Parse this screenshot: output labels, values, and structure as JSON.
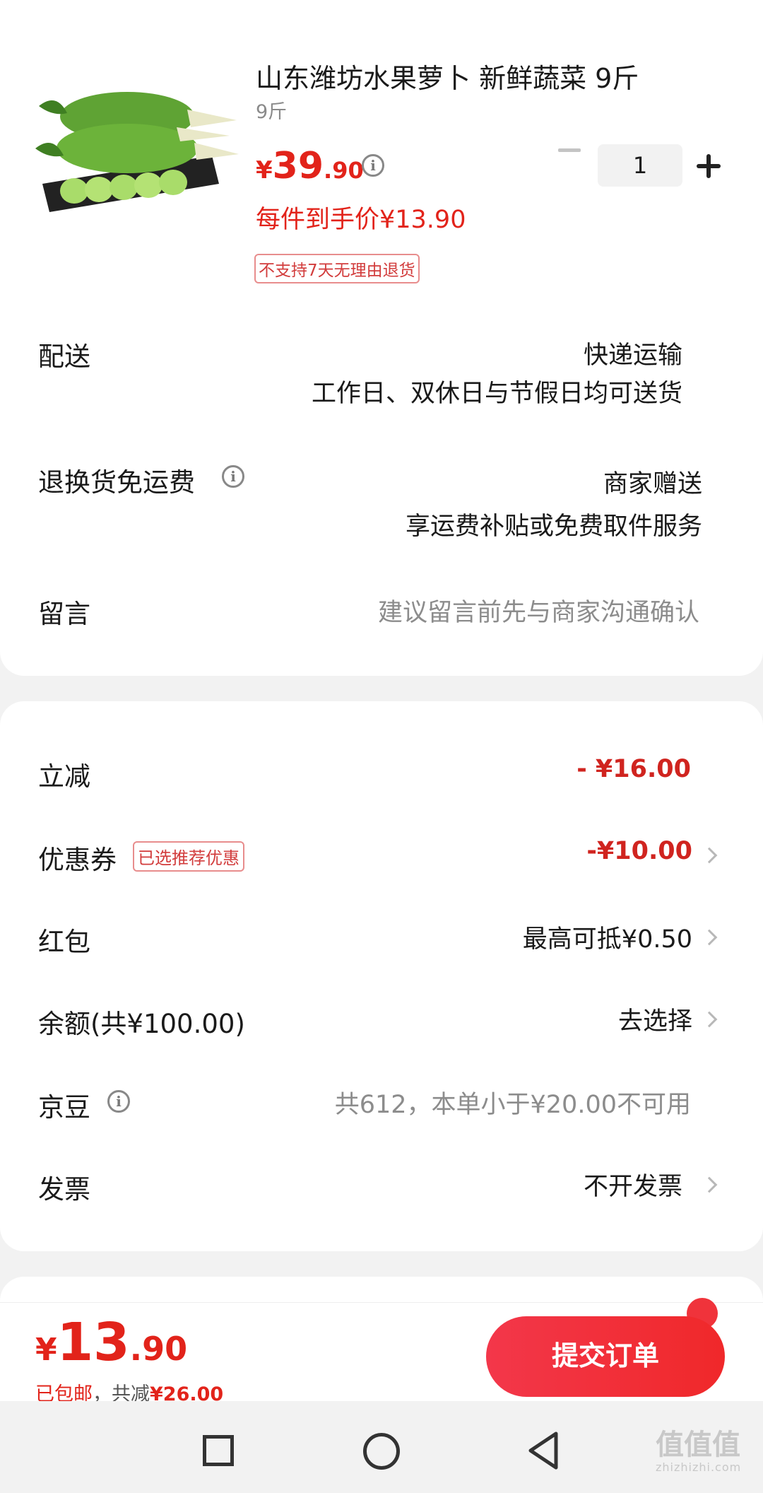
{
  "product": {
    "title": "山东潍坊水果萝卜 新鲜蔬菜 9斤",
    "spec": "9斤",
    "price_symbol": "¥",
    "price_int": "39",
    "price_dec": ".90",
    "per_price": "每件到手价¥13.90",
    "no_return": "不支持7天无理由退货",
    "quantity": "1",
    "icons": {
      "info": "info-icon",
      "minus": "minus-icon",
      "plus": "plus-icon"
    }
  },
  "delivery": {
    "label": "配送",
    "value": "快递运输",
    "detail": "工作日、双休日与节假日均可送货"
  },
  "return_shipping": {
    "label": "退换货免运费",
    "value": "商家赠送",
    "detail": "享运费补贴或免费取件服务"
  },
  "note": {
    "label": "留言",
    "placeholder": "建议留言前先与商家沟通确认"
  },
  "discounts": {
    "instant": {
      "label": "立减",
      "value": "- ¥16.00"
    },
    "coupon": {
      "label": "优惠券",
      "badge": "已选推荐优惠",
      "value": "-¥10.00"
    },
    "red_packet": {
      "label": "红包",
      "value": "最高可抵¥0.50"
    },
    "balance": {
      "label": "余额(共¥100.00)",
      "value": "去选择"
    },
    "jingdou": {
      "label": "京豆",
      "value": "共612，本单小于¥20.00不可用"
    },
    "invoice": {
      "label": "发票",
      "value": "不开发票"
    }
  },
  "footer": {
    "symbol": "¥",
    "total_int": "13",
    "total_dec": ".90",
    "shipping": "已包邮",
    "sep": "，共减",
    "saved": "¥26.00",
    "submit_label": "提交订单"
  },
  "watermark": {
    "big": "值值值",
    "small": "zhizhizhi.com"
  },
  "colors": {
    "accent": "#e2231a",
    "button": "#f0282a",
    "muted": "#8c8c8c"
  }
}
